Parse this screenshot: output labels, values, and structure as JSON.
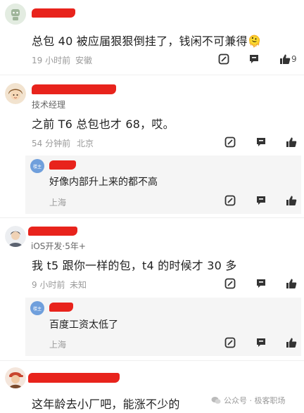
{
  "comments": [
    {
      "text": "总包 40 被应届狠狠倒挂了，钱闲不可兼得🫠",
      "time": "19 小时前",
      "location": "安徽",
      "likes": "9"
    },
    {
      "title": "技术经理",
      "text": "之前 T6 总包也才 68，哎。",
      "time": "54 分钟前",
      "location": "北京",
      "reply": {
        "badge": "楼主",
        "text": "好像内部升上来的都不高",
        "location": "上海"
      }
    },
    {
      "title": "iOS开发·5年+",
      "text": "我 t5 跟你一样的包，t4 的时候才 30 多",
      "time": "9 小时前",
      "location": "未知",
      "reply": {
        "badge": "楼主",
        "text": "百度工资太低了",
        "location": "上海"
      }
    },
    {
      "text": "这年龄去小厂吧，能涨不少的"
    }
  ],
  "watermark": "公众号 · 极客职场",
  "icons": {
    "edit": "edit-icon",
    "comment": "comment-icon",
    "like": "thumb-up-icon"
  }
}
